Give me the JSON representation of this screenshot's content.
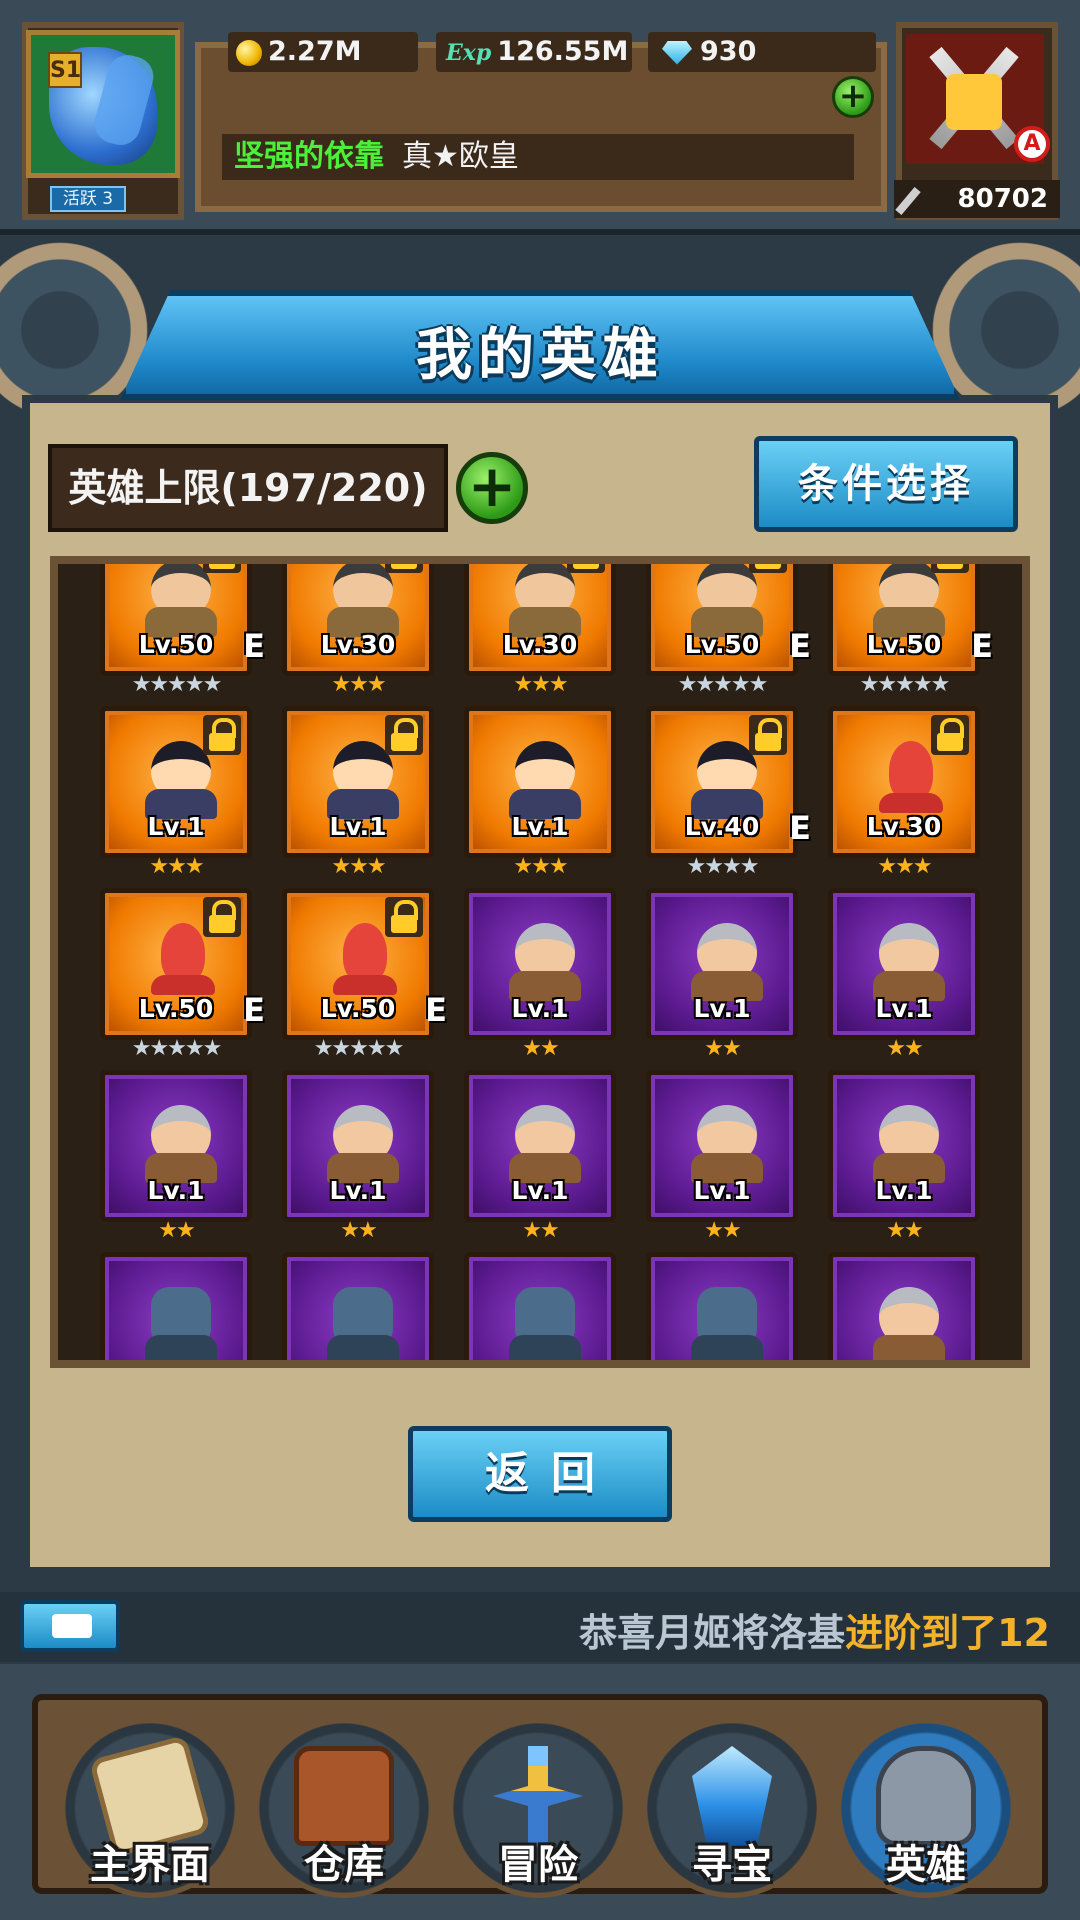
{
  "top_bar": {
    "season_badge": "S1",
    "activity_label": "活跃 3",
    "gold": "2.27M",
    "exp_tag": "Exp",
    "exp": "126.55M",
    "gems": "930",
    "plus_symbol": "+",
    "title_green": "坚强的依靠",
    "title_white": "真★欧皇",
    "grade_badge": "A",
    "combat_power": "80702"
  },
  "page": {
    "title": "我的英雄",
    "hero_limit": "英雄上限(197/220)",
    "filter_button": "条件选择",
    "back_button": "返回"
  },
  "heroes": [
    {
      "type": "warrior",
      "rarity": "orange",
      "level": "Lv.50",
      "stars": 5,
      "star_color": "silver",
      "evolved": "E",
      "locked": true
    },
    {
      "type": "warrior",
      "rarity": "orange",
      "level": "Lv.30",
      "stars": 3,
      "star_color": "gold",
      "evolved": "",
      "locked": true
    },
    {
      "type": "warrior",
      "rarity": "orange",
      "level": "Lv.30",
      "stars": 3,
      "star_color": "gold",
      "evolved": "",
      "locked": true
    },
    {
      "type": "warrior",
      "rarity": "orange",
      "level": "Lv.50",
      "stars": 5,
      "star_color": "silver",
      "evolved": "E",
      "locked": true
    },
    {
      "type": "warrior",
      "rarity": "orange",
      "level": "Lv.50",
      "stars": 5,
      "star_color": "silver",
      "evolved": "E",
      "locked": true
    },
    {
      "type": "zorro",
      "rarity": "orange",
      "level": "Lv.1",
      "stars": 3,
      "star_color": "gold",
      "evolved": "",
      "locked": true
    },
    {
      "type": "zorro",
      "rarity": "orange",
      "level": "Lv.1",
      "stars": 3,
      "star_color": "gold",
      "evolved": "",
      "locked": true
    },
    {
      "type": "zorro",
      "rarity": "orange",
      "level": "Lv.1",
      "stars": 3,
      "star_color": "gold",
      "evolved": "",
      "locked": false
    },
    {
      "type": "zorro",
      "rarity": "orange",
      "level": "Lv.40",
      "stars": 4,
      "star_color": "silver",
      "evolved": "E",
      "locked": true
    },
    {
      "type": "squid",
      "rarity": "orange",
      "level": "Lv.30",
      "stars": 3,
      "star_color": "gold",
      "evolved": "",
      "locked": true
    },
    {
      "type": "squid",
      "rarity": "orange",
      "level": "Lv.50",
      "stars": 5,
      "star_color": "silver",
      "evolved": "E",
      "locked": true
    },
    {
      "type": "squid",
      "rarity": "orange",
      "level": "Lv.50",
      "stars": 5,
      "star_color": "silver",
      "evolved": "E",
      "locked": true
    },
    {
      "type": "elder",
      "rarity": "purple",
      "level": "Lv.1",
      "stars": 2,
      "star_color": "gold",
      "evolved": "",
      "locked": false
    },
    {
      "type": "elder",
      "rarity": "purple",
      "level": "Lv.1",
      "stars": 2,
      "star_color": "gold",
      "evolved": "",
      "locked": false
    },
    {
      "type": "elder",
      "rarity": "purple",
      "level": "Lv.1",
      "stars": 2,
      "star_color": "gold",
      "evolved": "",
      "locked": false
    },
    {
      "type": "elder",
      "rarity": "purple",
      "level": "Lv.1",
      "stars": 2,
      "star_color": "gold",
      "evolved": "",
      "locked": false
    },
    {
      "type": "elder",
      "rarity": "purple",
      "level": "Lv.1",
      "stars": 2,
      "star_color": "gold",
      "evolved": "",
      "locked": false
    },
    {
      "type": "elder",
      "rarity": "purple",
      "level": "Lv.1",
      "stars": 2,
      "star_color": "gold",
      "evolved": "",
      "locked": false
    },
    {
      "type": "elder",
      "rarity": "purple",
      "level": "Lv.1",
      "stars": 2,
      "star_color": "gold",
      "evolved": "",
      "locked": false
    },
    {
      "type": "elder",
      "rarity": "purple",
      "level": "Lv.1",
      "stars": 2,
      "star_color": "gold",
      "evolved": "",
      "locked": false
    },
    {
      "type": "robot",
      "rarity": "purple",
      "level": "",
      "stars": 0,
      "star_color": "gold",
      "evolved": "",
      "locked": false
    },
    {
      "type": "robot",
      "rarity": "purple",
      "level": "",
      "stars": 0,
      "star_color": "gold",
      "evolved": "",
      "locked": false
    },
    {
      "type": "robot",
      "rarity": "purple",
      "level": "",
      "stars": 0,
      "star_color": "gold",
      "evolved": "",
      "locked": false
    },
    {
      "type": "robot",
      "rarity": "purple",
      "level": "",
      "stars": 0,
      "star_color": "gold",
      "evolved": "",
      "locked": false
    },
    {
      "type": "elder",
      "rarity": "purple",
      "level": "",
      "stars": 0,
      "star_color": "gold",
      "evolved": "",
      "locked": false
    }
  ],
  "ticker": {
    "text_plain": "恭喜月姬将洛基",
    "text_highlight": "进阶到了12"
  },
  "nav": [
    {
      "label": "主界面",
      "icon": "scroll-icon"
    },
    {
      "label": "仓库",
      "icon": "chest-icon"
    },
    {
      "label": "冒险",
      "icon": "sword-icon"
    },
    {
      "label": "寻宝",
      "icon": "crystal-icon"
    },
    {
      "label": "英雄",
      "icon": "helmet-icon"
    }
  ],
  "colors": {
    "orange_frame": "#f07a00",
    "purple_frame": "#5a1a8e",
    "blue_button": "#1c8cc6",
    "highlight_text": "#f3b22a"
  }
}
